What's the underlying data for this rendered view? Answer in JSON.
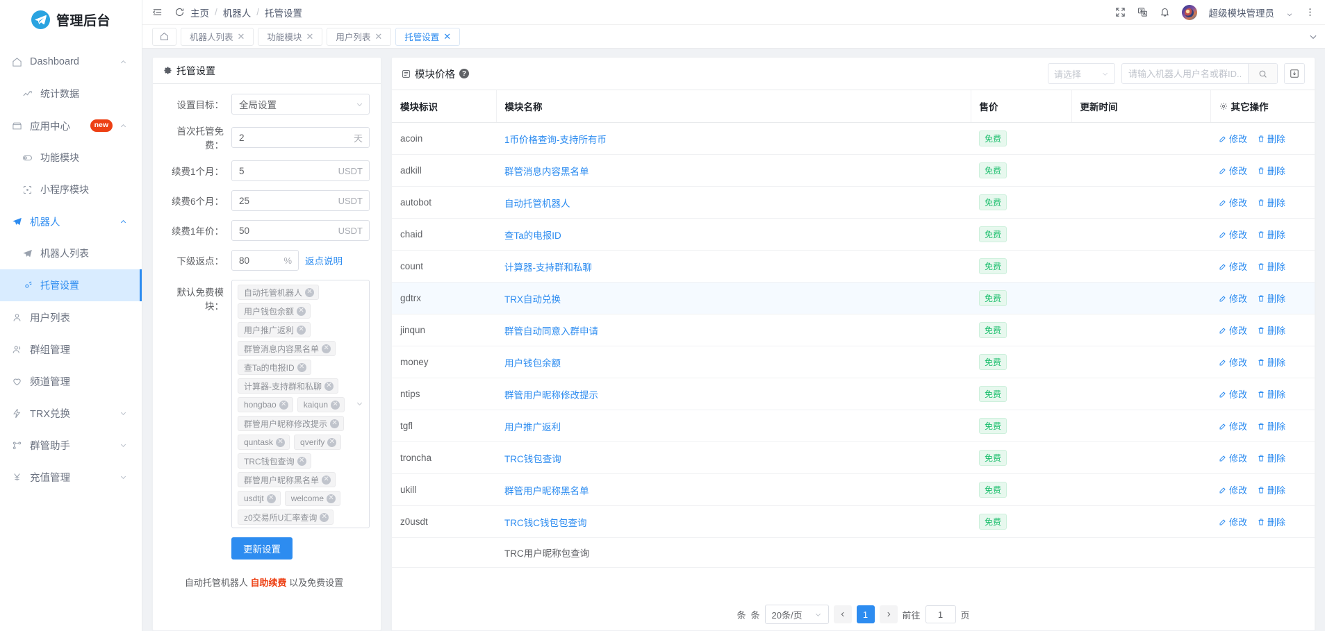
{
  "brand": {
    "title": "管理后台",
    "logo_icon": "telegram-paper-plane-icon"
  },
  "sidebar": {
    "items": [
      {
        "label": "Dashboard",
        "icon": "home-icon",
        "arrow": "chevron-up",
        "level": "top"
      },
      {
        "label": "统计数据",
        "icon": "trend-up-icon",
        "level": "sub"
      },
      {
        "label": "应用中心",
        "icon": "store-icon",
        "badge": "new",
        "arrow": "chevron-up",
        "level": "top"
      },
      {
        "label": "功能模块",
        "icon": "module-icon",
        "level": "sub"
      },
      {
        "label": "小程序模块",
        "icon": "miniapp-icon",
        "level": "sub"
      },
      {
        "label": "机器人",
        "icon": "paper-plane-icon",
        "arrow": "chevron-up",
        "level": "top",
        "state": "expanded"
      },
      {
        "label": "机器人列表",
        "icon": "paper-plane-icon",
        "level": "sub"
      },
      {
        "label": "托管设置",
        "icon": "gear-icon",
        "level": "sub",
        "state": "selected"
      },
      {
        "label": "用户列表",
        "icon": "user-icon",
        "level": "top"
      },
      {
        "label": "群组管理",
        "icon": "users-icon",
        "level": "top"
      },
      {
        "label": "频道管理",
        "icon": "heart-icon",
        "level": "top"
      },
      {
        "label": "TRX兑换",
        "icon": "bolt-icon",
        "arrow": "chevron-down",
        "level": "top"
      },
      {
        "label": "群管助手",
        "icon": "share-icon",
        "arrow": "chevron-down",
        "level": "top"
      },
      {
        "label": "充值管理",
        "icon": "yen-icon",
        "arrow": "chevron-down",
        "level": "top"
      }
    ]
  },
  "topbar": {
    "collapse_icon": "collapse-menu-icon",
    "refresh_icon": "refresh-icon",
    "breadcrumb": [
      "主页",
      "机器人",
      "托管设置"
    ],
    "separator": "/",
    "fullscreen_icon": "fullscreen-icon",
    "language_icon": "translate-icon",
    "bell_icon": "bell-icon",
    "user_name": "超级模块管理员",
    "more_icon": "more-vertical-icon"
  },
  "tabs": {
    "home_icon": "home-icon",
    "items": [
      {
        "label": "机器人列表",
        "active": false
      },
      {
        "label": "功能模块",
        "active": false
      },
      {
        "label": "用户列表",
        "active": false
      },
      {
        "label": "托管设置",
        "active": true
      }
    ],
    "close_glyph": "✕",
    "more_icon": "chevron-down-icon"
  },
  "settings_panel": {
    "title": "托管设置",
    "title_icon": "gear-icon",
    "fields": [
      {
        "label": "设置目标：",
        "value": "全局设置",
        "type": "select"
      },
      {
        "label": "首次托管免费：",
        "value": "2",
        "suffix": "天",
        "type": "input"
      },
      {
        "label": "续费1个月：",
        "value": "5",
        "suffix": "USDT",
        "type": "input"
      },
      {
        "label": "续费6个月：",
        "value": "25",
        "suffix": "USDT",
        "type": "input"
      },
      {
        "label": "续费1年价：",
        "value": "50",
        "suffix": "USDT",
        "type": "input"
      }
    ],
    "rebate": {
      "label": "下级返点：",
      "value": "80",
      "suffix": "%",
      "link": "返点说明"
    },
    "free_modules": {
      "label": "默认免费模块：",
      "tags": [
        "自动托管机器人",
        "用户钱包余额",
        "用户推广返利",
        "群管消息内容黑名单",
        "查Ta的电报ID",
        "计算器-支持群和私聊",
        "hongbao",
        "kaiqun",
        "群管用户昵称修改提示",
        "quntask",
        "qverify",
        "TRC钱包查询",
        "群管用户昵称黑名单",
        "usdtjt",
        "welcome",
        "z0交易所U汇率查询"
      ]
    },
    "submit_label": "更新设置",
    "footer_note": {
      "pre": "自动托管机器人 ",
      "hot": "自助续费",
      "post": " 以及免费设置"
    }
  },
  "module_price": {
    "title": "模块价格",
    "title_icon": "list-icon",
    "help_icon": "question-icon",
    "filter": {
      "placeholder": "请选择",
      "icon": "chevron-down-icon"
    },
    "search": {
      "placeholder": "请输入机器人用户名或群ID...",
      "value": "",
      "icon": "search-icon"
    },
    "export_icon": "export-icon",
    "columns": [
      "模块标识",
      "模块名称",
      "售价",
      "更新时间",
      "其它操作"
    ],
    "ops_header_icon": "gear-icon",
    "op_edit": {
      "label": "修改",
      "icon": "edit-icon"
    },
    "op_delete": {
      "label": "删除",
      "icon": "delete-icon"
    },
    "free_label": "免费",
    "rows": [
      {
        "id": "acoin",
        "name": "1币价格查询-支持所有币",
        "price": "免费",
        "updated": ""
      },
      {
        "id": "adkill",
        "name": "群管消息内容黑名单",
        "price": "免费",
        "updated": ""
      },
      {
        "id": "autobot",
        "name": "自动托管机器人",
        "price": "免费",
        "updated": ""
      },
      {
        "id": "chaid",
        "name": "查Ta的电报ID",
        "price": "免费",
        "updated": ""
      },
      {
        "id": "count",
        "name": "计算器-支持群和私聊",
        "price": "免费",
        "updated": ""
      },
      {
        "id": "gdtrx",
        "name": "TRX自动兑换",
        "price": "免费",
        "updated": "",
        "highlight": true
      },
      {
        "id": "jinqun",
        "name": "群管自动同意入群申请",
        "price": "免费",
        "updated": ""
      },
      {
        "id": "money",
        "name": "用户钱包余额",
        "price": "免费",
        "updated": ""
      },
      {
        "id": "ntips",
        "name": "群管用户昵称修改提示",
        "price": "免费",
        "updated": ""
      },
      {
        "id": "tgfl",
        "name": "用户推广返利",
        "price": "免费",
        "updated": ""
      },
      {
        "id": "troncha",
        "name": "TRC钱包查询",
        "price": "免费",
        "updated": ""
      },
      {
        "id": "ukill",
        "name": "群管用户昵称黑名单",
        "price": "免费",
        "updated": ""
      },
      {
        "id": "z0usdt",
        "name": "TRC钱C钱包包查询",
        "price": "免费",
        "updated": ""
      }
    ],
    "partial_row_name": "TRC用户昵称包查询",
    "pagination": {
      "unit_left": "条",
      "unit_right": "条",
      "page_size": "20条/页",
      "prev_icon": "chevron-left-icon",
      "next_icon": "chevron-right-icon",
      "current_page": "1",
      "goto_label": "前往",
      "goto_value": "1",
      "page_label": "页"
    }
  },
  "colors": {
    "primary": "#2d8cf0",
    "success": "#19be6b",
    "danger": "#ed4014",
    "selected_bg": "#d9ecff"
  }
}
